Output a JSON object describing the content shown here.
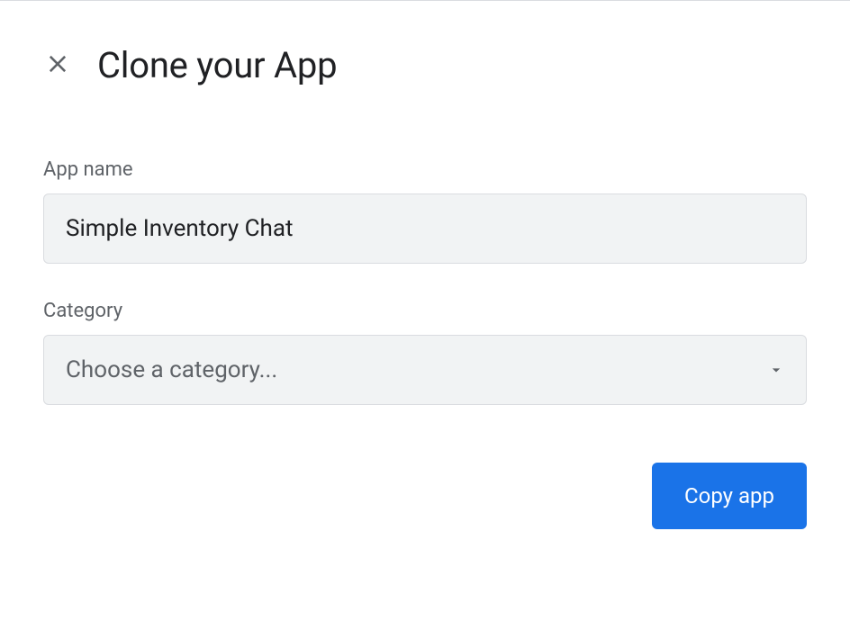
{
  "dialog": {
    "title": "Clone your App",
    "fields": {
      "appName": {
        "label": "App name",
        "value": "Simple Inventory Chat"
      },
      "category": {
        "label": "Category",
        "placeholder": "Choose a category..."
      }
    },
    "actions": {
      "primary": "Copy app"
    }
  }
}
